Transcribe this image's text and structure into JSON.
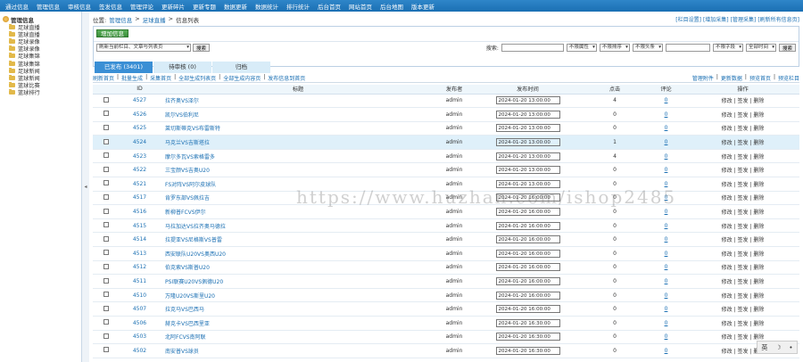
{
  "topnav": [
    "通过信息",
    "管理信息",
    "审核信息",
    "签发信息",
    "管理评论",
    "更新碎片",
    "更新专题",
    "数据更新",
    "数据统计",
    "排行统计",
    "后台首页",
    "网站首页",
    "后台地图",
    "版本更新"
  ],
  "sidebar": {
    "root": "管理信息",
    "items": [
      "足球直播",
      "篮球直播",
      "足球录像",
      "篮球录像",
      "足球集锦",
      "篮球集锦",
      "足球新闻",
      "篮球新闻",
      "篮球比赛",
      "篮球排行"
    ]
  },
  "breadcrumb": {
    "label": "位置:",
    "items": [
      "管理信息",
      "足球直播",
      "信息列表"
    ]
  },
  "top_links": [
    "[栏目设置]",
    "[增加采集]",
    "[管理采集]",
    "[刷新所有信息页]"
  ],
  "add_button": "增加信息",
  "search": {
    "value": "刷新当前栏目、文章与列表页",
    "button": "搜索"
  },
  "filters": {
    "label": "搜索:",
    "selects": [
      "不限属性",
      "不限排序",
      "不限头条",
      "不限字段",
      "全部时间"
    ],
    "button": "搜索"
  },
  "tabs": [
    {
      "label": "已发布 (3401)",
      "active": true
    },
    {
      "label": "待审核 (0)",
      "active": false
    },
    {
      "label": "归档",
      "active": false
    }
  ],
  "op_links_left": [
    "刷新首页",
    "|",
    "批量生成",
    "|",
    "采集首页",
    "|",
    "全部生成列表页",
    "|",
    "全部生成内容页",
    "|",
    "发布信息到首页"
  ],
  "op_links_right": [
    "管理附件",
    "|",
    "更新数据",
    "|",
    "预览首页",
    "|",
    "预览栏目"
  ],
  "columns": [
    "",
    "ID",
    "标题",
    "发布者",
    "发布时间",
    "点击",
    "评论",
    "操作"
  ],
  "rows": [
    {
      "id": "4527",
      "title": "拉齐奥VS泽尔",
      "author": "admin",
      "time": "2024-01-20 13:00:00",
      "clicks": "4",
      "comments": "0",
      "hl": false
    },
    {
      "id": "4526",
      "title": "凯尔VS伯利尼",
      "author": "admin",
      "time": "2024-01-20 13:00:00",
      "clicks": "0",
      "comments": "0",
      "hl": false
    },
    {
      "id": "4525",
      "title": "莱切斯蒂克VS布雷斯特",
      "author": "admin",
      "time": "2024-01-20 13:00:00",
      "clicks": "0",
      "comments": "0",
      "hl": false
    },
    {
      "id": "4524",
      "title": "马克兰VS吉斯塔拉",
      "author": "admin",
      "time": "2024-01-20 13:00:00",
      "clicks": "1",
      "comments": "0",
      "hl": true
    },
    {
      "id": "4523",
      "title": "摩尔多瓦VS索格雷多",
      "author": "admin",
      "time": "2024-01-20 13:00:00",
      "clicks": "4",
      "comments": "0",
      "hl": false
    },
    {
      "id": "4522",
      "title": "三宝颜VS吉奥U20",
      "author": "admin",
      "time": "2024-01-20 13:00:00",
      "clicks": "0",
      "comments": "0",
      "hl": false
    },
    {
      "id": "4521",
      "title": "FS对阵VS阿尔皮球队",
      "author": "admin",
      "time": "2024-01-20 13:00:00",
      "clicks": "0",
      "comments": "0",
      "hl": false
    },
    {
      "id": "4517",
      "title": "肯罗东部VS佩拉吉",
      "author": "admin",
      "time": "2024-01-20 16:00:00",
      "clicks": "0",
      "comments": "0",
      "hl": false
    },
    {
      "id": "4516",
      "title": "新柳普FCVS伊尔",
      "author": "admin",
      "time": "2024-01-20 16:00:00",
      "clicks": "0",
      "comments": "0",
      "hl": false
    },
    {
      "id": "4515",
      "title": "马拉加达VS拉齐奥马德拉",
      "author": "admin",
      "time": "2024-01-20 16:00:00",
      "clicks": "0",
      "comments": "0",
      "hl": false
    },
    {
      "id": "4514",
      "title": "拉提亚VS尼格斯VS普雷",
      "author": "admin",
      "time": "2024-01-20 16:00:00",
      "clicks": "0",
      "comments": "0",
      "hl": false
    },
    {
      "id": "4513",
      "title": "西安联队U20VS奥西U20",
      "author": "admin",
      "time": "2024-01-20 16:00:00",
      "clicks": "0",
      "comments": "0",
      "hl": false
    },
    {
      "id": "4512",
      "title": "伯克索VS斯普U20",
      "author": "admin",
      "time": "2024-01-20 16:00:00",
      "clicks": "0",
      "comments": "0",
      "hl": false
    },
    {
      "id": "4511",
      "title": "PSI联赛U20VS佩德U20",
      "author": "admin",
      "time": "2024-01-20 16:00:00",
      "clicks": "0",
      "comments": "0",
      "hl": false
    },
    {
      "id": "4510",
      "title": "万隆U20VS斯里U20",
      "author": "admin",
      "time": "2024-01-20 16:00:00",
      "clicks": "0",
      "comments": "0",
      "hl": false
    },
    {
      "id": "4507",
      "title": "拉克马VS巴西马",
      "author": "admin",
      "time": "2024-01-20 16:00:00",
      "clicks": "0",
      "comments": "0",
      "hl": false
    },
    {
      "id": "4506",
      "title": "赫克卡VS巴西里亚",
      "author": "admin",
      "time": "2024-01-20 16:30:00",
      "clicks": "0",
      "comments": "0",
      "hl": false
    },
    {
      "id": "4503",
      "title": "北阿FCVS南阿联",
      "author": "admin",
      "time": "2024-01-20 16:30:00",
      "clicks": "0",
      "comments": "0",
      "hl": false
    },
    {
      "id": "4502",
      "title": "南安普VS球员",
      "author": "admin",
      "time": "2024-01-20 16:30:00",
      "clicks": "0",
      "comments": "0",
      "hl": false
    }
  ],
  "row_ops": [
    "修改",
    "|",
    "签发",
    "|",
    "删除"
  ],
  "watermark": "https://www.huzhan.com/ishop2485",
  "ime": {
    "lang": "英",
    "moon": "☽",
    "dot": "•"
  }
}
